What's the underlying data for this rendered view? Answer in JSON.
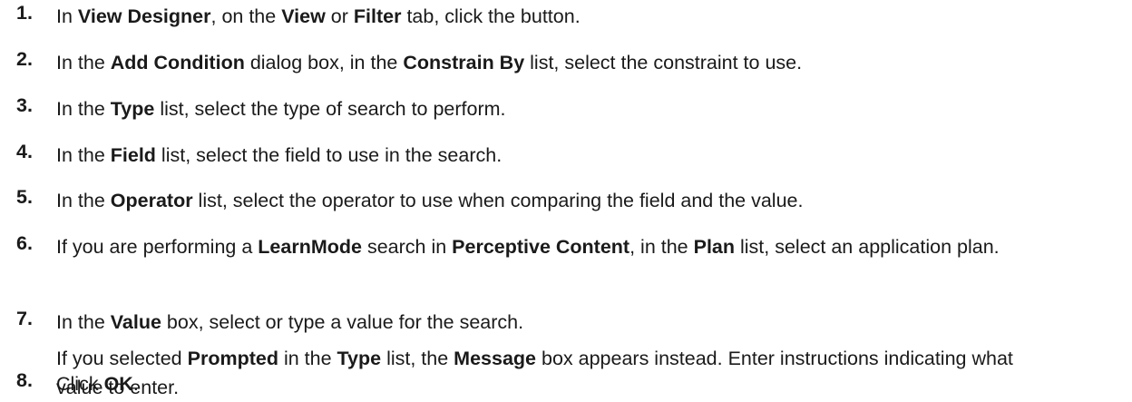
{
  "steps": [
    {
      "number": "1.",
      "paragraphs": [
        [
          {
            "t": "In "
          },
          {
            "b": "View Designer"
          },
          {
            "t": ", on the "
          },
          {
            "b": "View"
          },
          {
            "t": " or "
          },
          {
            "b": "Filter"
          },
          {
            "t": " tab, click the  button."
          }
        ]
      ]
    },
    {
      "number": "2.",
      "paragraphs": [
        [
          {
            "t": "In the "
          },
          {
            "b": "Add Condition"
          },
          {
            "t": " dialog box, in the "
          },
          {
            "b": "Constrain By"
          },
          {
            "t": " list, select the constraint to use."
          }
        ]
      ]
    },
    {
      "number": "3.",
      "paragraphs": [
        [
          {
            "t": "In the "
          },
          {
            "b": "Type"
          },
          {
            "t": " list, select the type of search to perform."
          }
        ]
      ]
    },
    {
      "number": "4.",
      "paragraphs": [
        [
          {
            "t": "In the "
          },
          {
            "b": "Field"
          },
          {
            "t": " list, select the field to use in the search."
          }
        ]
      ]
    },
    {
      "number": "5.",
      "paragraphs": [
        [
          {
            "t": "In the "
          },
          {
            "b": "Operator"
          },
          {
            "t": " list, select the operator to use when comparing the field and the value."
          }
        ]
      ]
    },
    {
      "number": "6.",
      "paragraphs": [
        [
          {
            "t": "If you are performing a "
          },
          {
            "b": "LearnMode"
          },
          {
            "t": " search in "
          },
          {
            "b": "Perceptive Content"
          },
          {
            "t": ", in the "
          },
          {
            "b": "Plan"
          },
          {
            "t": " list, select an application plan."
          }
        ]
      ]
    },
    {
      "number": "7.",
      "paragraphs": [
        [
          {
            "t": "In the "
          },
          {
            "b": "Value"
          },
          {
            "t": " box, select or type a value for the search."
          }
        ],
        [
          {
            "t": "If you selected "
          },
          {
            "b": "Prompted"
          },
          {
            "t": " in the "
          },
          {
            "b": "Type"
          },
          {
            "t": " list, the "
          },
          {
            "b": "Message"
          },
          {
            "t": " box appears instead. Enter instructions indicating what value to enter."
          }
        ]
      ]
    },
    {
      "number": "8.",
      "paragraphs": [
        [
          {
            "t": "Click "
          },
          {
            "b": "OK"
          },
          {
            "t": "."
          }
        ]
      ]
    }
  ]
}
